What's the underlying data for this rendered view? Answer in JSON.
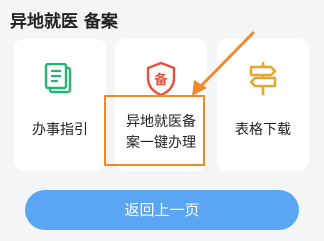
{
  "section_title": "异地就医 备案",
  "cards": [
    {
      "label": "办事指引",
      "icon": "document-list-icon",
      "color": "#22b573"
    },
    {
      "label": "异地就医备案一键办理",
      "label_line1": "异地就医备",
      "label_line2": "案一键办理",
      "icon": "shield-badge-icon",
      "badge_char": "备",
      "color": "#e8503a"
    },
    {
      "label": "表格下载",
      "icon": "signpost-icon",
      "color": "#e8a629"
    }
  ],
  "back_button": {
    "label": "返回上一页"
  },
  "highlight_color": "#f0892b"
}
